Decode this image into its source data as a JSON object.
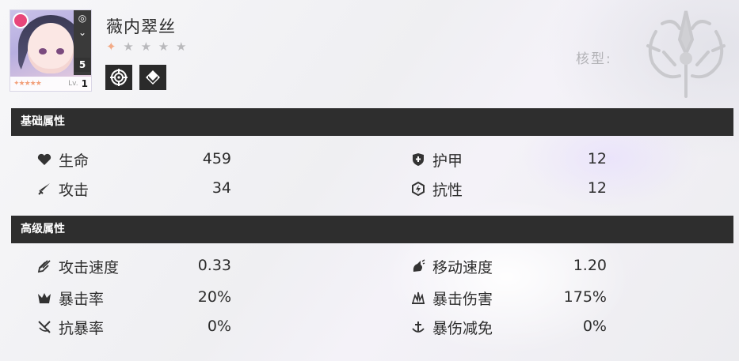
{
  "character": {
    "name": "薇内翠丝",
    "stars_filled": "✦",
    "stars_empty": "★ ★ ★ ★",
    "portrait": {
      "rank": "5",
      "lv_label": "Lv.",
      "level": "1",
      "mini_stars": "✦★★★★"
    }
  },
  "core": {
    "label": "核型:"
  },
  "sections": {
    "basic_title": "基础属性",
    "advanced_title": "高级属性"
  },
  "basic_stats": {
    "hp": {
      "label": "生命",
      "value": "459",
      "icon": "heart-icon"
    },
    "armor": {
      "label": "护甲",
      "value": "12",
      "icon": "shield-icon"
    },
    "attack": {
      "label": "攻击",
      "value": "34",
      "icon": "sword-icon"
    },
    "resist": {
      "label": "抗性",
      "value": "12",
      "icon": "resist-icon"
    }
  },
  "advanced_stats": {
    "atk_speed": {
      "label": "攻击速度",
      "value": "0.33",
      "icon": "attack-speed-icon"
    },
    "move_speed": {
      "label": "移动速度",
      "value": "1.20",
      "icon": "move-speed-icon"
    },
    "crit_rate": {
      "label": "暴击率",
      "value": "20%",
      "icon": "crit-rate-icon"
    },
    "crit_dmg": {
      "label": "暴击伤害",
      "value": "175%",
      "icon": "crit-damage-icon"
    },
    "crit_resist": {
      "label": "抗暴率",
      "value": "0%",
      "icon": "crit-resist-icon"
    },
    "crit_dmg_reduce": {
      "label": "暴伤减免",
      "value": "0%",
      "icon": "crit-damage-reduction-icon"
    }
  },
  "colors": {
    "section_bar": "#2e2e2e",
    "star_accent": "#f3ab87",
    "text": "#2c2c2c"
  }
}
